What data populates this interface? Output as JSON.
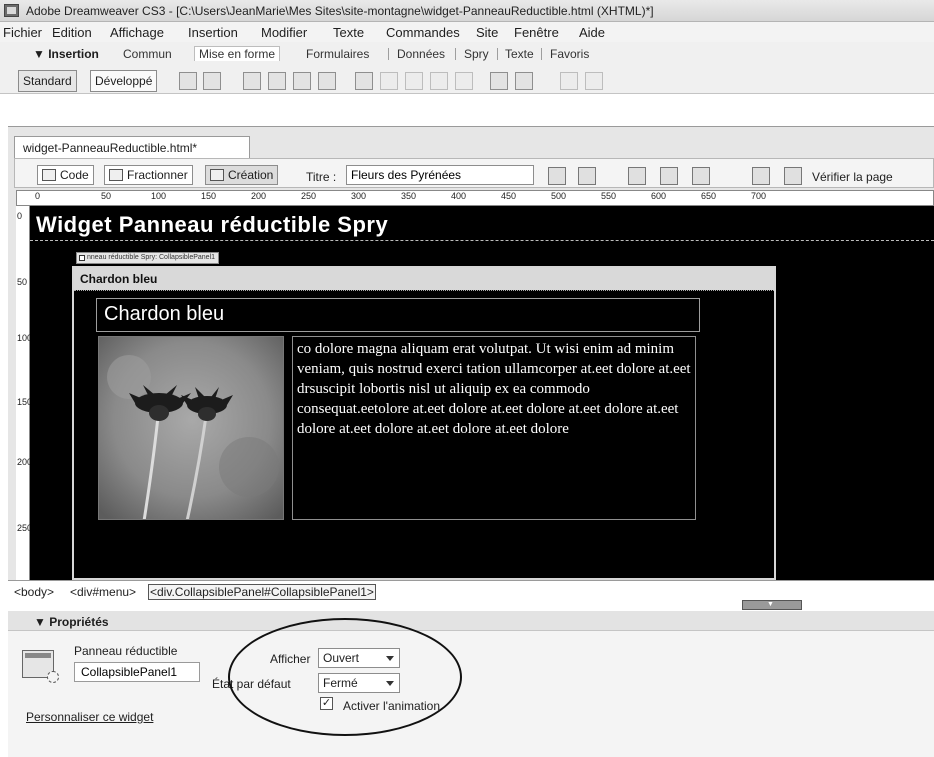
{
  "window": {
    "title": "Adobe Dreamweaver CS3 - [C:\\Users\\JeanMarie\\Mes Sites\\site-montagne\\widget-PanneauReductible.html (XHTML)*]"
  },
  "menu": [
    "Fichier",
    "Edition",
    "Affichage",
    "Insertion",
    "Modifier",
    "Texte",
    "Commandes",
    "Site",
    "Fenêtre",
    "Aide"
  ],
  "insert_bar": {
    "title": "▼ Insertion",
    "tabs": [
      "Commun",
      "Mise en forme",
      "Formulaires",
      "Données",
      "Spry",
      "Texte",
      "Favoris"
    ],
    "active_tab": "Mise en forme",
    "modes": [
      "Standard",
      "Développé"
    ]
  },
  "document": {
    "tab_label": "widget-PanneauReductible.html*",
    "views": [
      "Code",
      "Fractionner",
      "Création"
    ],
    "active_view": "Création",
    "title_label": "Titre :",
    "title_value": "Fleurs des Pyrénées",
    "check_page": "Vérifier la page"
  },
  "ruler": {
    "numbers": [
      "0",
      "50",
      "100",
      "150",
      "200",
      "250",
      "300",
      "350",
      "400",
      "450",
      "500",
      "550",
      "600",
      "650",
      "700"
    ],
    "vertical_numbers": [
      "0",
      "50",
      "100",
      "150",
      "200",
      "250"
    ]
  },
  "canvas": {
    "page_heading": "Widget Panneau réductible Spry",
    "spry_tag": "nneau réductible Spry: CollapsiblePanel1",
    "panel_tab": "Chardon bleu",
    "content_title": "Chardon bleu",
    "body_text": "co dolore magna aliquam erat volutpat. Ut wisi enim ad minim veniam, quis nostrud exerci tation ullamcorper at.eet dolore at.eet drsuscipit lobortis nisl ut aliquip ex ea commodo consequat.eetolore at.eet dolore at.eet dolore at.eet dolore at.eet dolore at.eet dolore at.eet dolore at.eet dolore"
  },
  "tag_selector": [
    "<body>",
    "<div#menu>",
    "<div.CollapsiblePanel#CollapsiblePanel1>"
  ],
  "properties": {
    "title": "▼ Propriétés",
    "type_label": "Panneau réductible",
    "id_value": "CollapsiblePanel1",
    "customize_link": "Personnaliser ce widget",
    "display_label": "Afficher",
    "display_value": "Ouvert",
    "default_state_label": "État par défaut",
    "default_state_value": "Fermé",
    "animation_label": "Activer l'animation",
    "animation_checked": true,
    "check_mark": "✓"
  }
}
